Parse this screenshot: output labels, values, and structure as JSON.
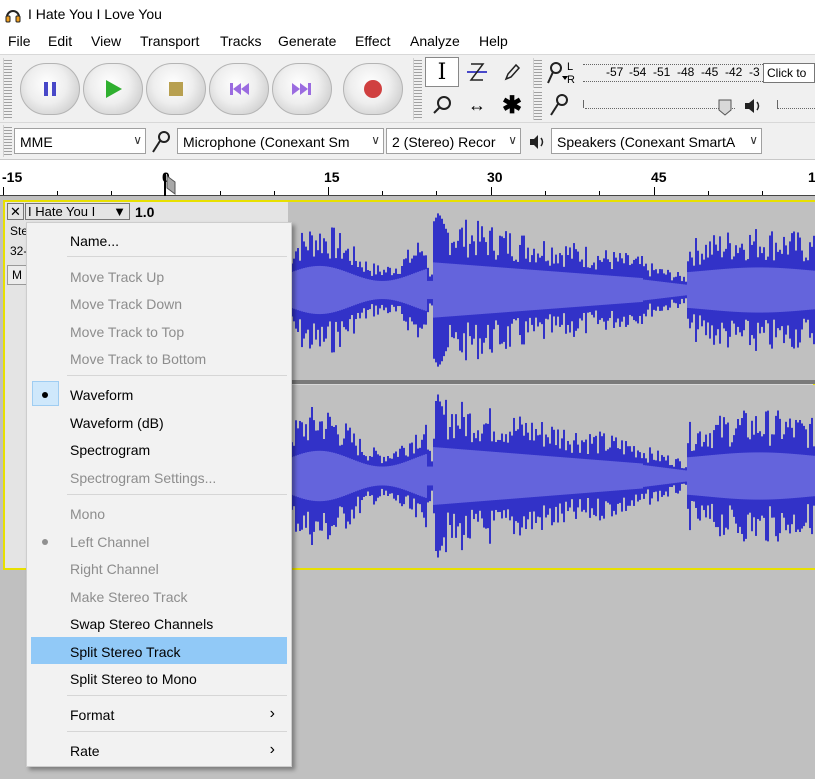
{
  "window": {
    "title": "I Hate You I Love You",
    "icon": "headphones-icon"
  },
  "menubar": [
    "File",
    "Edit",
    "View",
    "Transport",
    "Tracks",
    "Generate",
    "Effect",
    "Analyze",
    "Help"
  ],
  "transport": {
    "buttons": [
      "pause",
      "play",
      "stop",
      "skip-to-start",
      "skip-to-end",
      "record"
    ]
  },
  "tools": [
    "selection-tool",
    "envelope-tool",
    "draw-tool",
    "zoom-tool",
    "time-shift-tool",
    "multi-tool"
  ],
  "meters": {
    "record_label": "L R",
    "scale": [
      "-57",
      "-54",
      "-51",
      "-48",
      "-45",
      "-42",
      "-3"
    ],
    "click_hint": "Click to"
  },
  "devices": {
    "host": "MME",
    "recording_device": "Microphone (Conexant Sm",
    "channels": "2 (Stereo) Recor",
    "playback_device": "Speakers (Conexant SmartA"
  },
  "ruler": {
    "labels": [
      "-15",
      "0",
      "15",
      "30",
      "45",
      "1"
    ]
  },
  "track": {
    "name": "I Hate You I",
    "gain": "1.0",
    "info_line1": "Ste",
    "info_line2": "32-",
    "mute_label": "M"
  },
  "context_menu": {
    "items": [
      {
        "label": "Name...",
        "enabled": true
      },
      {
        "label": "Move Track Up",
        "enabled": false
      },
      {
        "label": "Move Track Down",
        "enabled": false
      },
      {
        "label": "Move Track to Top",
        "enabled": false
      },
      {
        "label": "Move Track to Bottom",
        "enabled": false
      },
      {
        "label": "Waveform",
        "enabled": true,
        "checked": true
      },
      {
        "label": "Waveform (dB)",
        "enabled": true
      },
      {
        "label": "Spectrogram",
        "enabled": true
      },
      {
        "label": "Spectrogram Settings...",
        "enabled": false
      },
      {
        "label": "Mono",
        "enabled": false
      },
      {
        "label": "Left Channel",
        "enabled": false,
        "checked": true
      },
      {
        "label": "Right Channel",
        "enabled": false
      },
      {
        "label": "Make Stereo Track",
        "enabled": false
      },
      {
        "label": "Swap Stereo Channels",
        "enabled": true
      },
      {
        "label": "Split Stereo Track",
        "enabled": true,
        "highlighted": true
      },
      {
        "label": "Split Stereo to Mono",
        "enabled": true
      },
      {
        "label": "Format",
        "enabled": true,
        "submenu": true
      },
      {
        "label": "Rate",
        "enabled": true,
        "submenu": true
      }
    ]
  },
  "colors": {
    "waveform": "#3232c8",
    "waveform_rms": "#6464dc",
    "selection_highlight": "#91c9f7",
    "track_focus": "#e8e000"
  }
}
